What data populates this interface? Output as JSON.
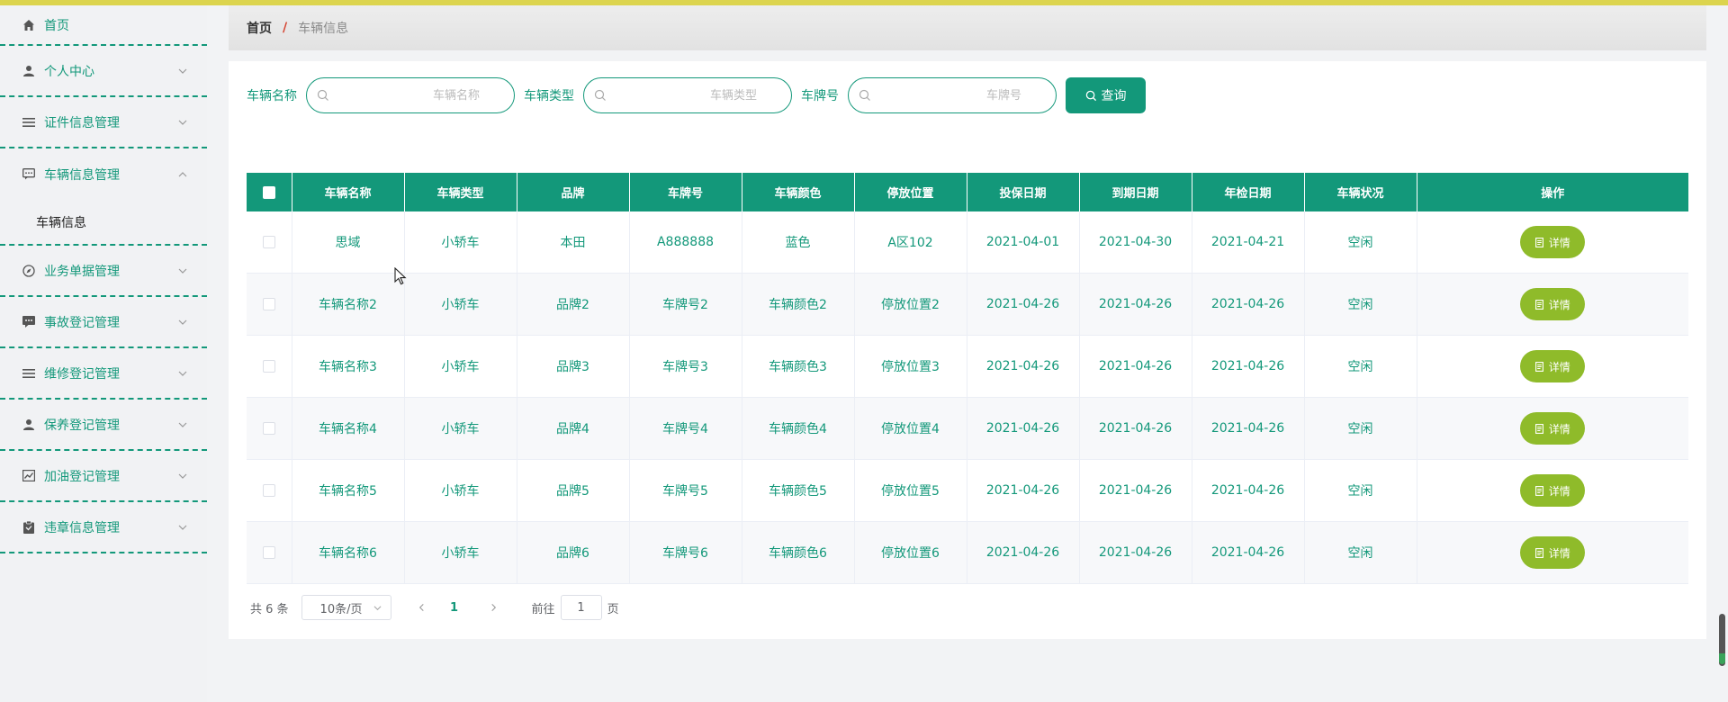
{
  "sidebar": {
    "items": [
      {
        "label": "首页",
        "icon": "home-icon",
        "expanded": false
      },
      {
        "label": "个人中心",
        "icon": "user-icon",
        "expanded": false
      },
      {
        "label": "证件信息管理",
        "icon": "list-icon",
        "expanded": false
      },
      {
        "label": "车辆信息管理",
        "icon": "chat-icon",
        "expanded": true,
        "subitems": [
          "车辆信息"
        ]
      },
      {
        "label": "业务单据管理",
        "icon": "compass-icon",
        "expanded": false
      },
      {
        "label": "事故登记管理",
        "icon": "message-icon",
        "expanded": false
      },
      {
        "label": "维修登记管理",
        "icon": "list-icon",
        "expanded": false
      },
      {
        "label": "保养登记管理",
        "icon": "user-icon",
        "expanded": false
      },
      {
        "label": "加油登记管理",
        "icon": "chart-icon",
        "expanded": false
      },
      {
        "label": "违章信息管理",
        "icon": "clipboard-icon",
        "expanded": false
      }
    ]
  },
  "breadcrumb": {
    "home": "首页",
    "separator": "/",
    "current": "车辆信息"
  },
  "search": {
    "name": {
      "label": "车辆名称",
      "placeholder": "车辆名称"
    },
    "type": {
      "label": "车辆类型",
      "placeholder": "车辆类型"
    },
    "plate": {
      "label": "车牌号",
      "placeholder": "车牌号"
    },
    "query_label": "查询"
  },
  "table": {
    "columns": [
      "车辆名称",
      "车辆类型",
      "品牌",
      "车牌号",
      "车辆颜色",
      "停放位置",
      "投保日期",
      "到期日期",
      "年检日期",
      "车辆状况",
      "操作"
    ],
    "rows": [
      [
        "思域",
        "小轿车",
        "本田",
        "A888888",
        "蓝色",
        "A区102",
        "2021-04-01",
        "2021-04-30",
        "2021-04-21",
        "空闲"
      ],
      [
        "车辆名称2",
        "小轿车",
        "品牌2",
        "车牌号2",
        "车辆颜色2",
        "停放位置2",
        "2021-04-26",
        "2021-04-26",
        "2021-04-26",
        "空闲"
      ],
      [
        "车辆名称3",
        "小轿车",
        "品牌3",
        "车牌号3",
        "车辆颜色3",
        "停放位置3",
        "2021-04-26",
        "2021-04-26",
        "2021-04-26",
        "空闲"
      ],
      [
        "车辆名称4",
        "小轿车",
        "品牌4",
        "车牌号4",
        "车辆颜色4",
        "停放位置4",
        "2021-04-26",
        "2021-04-26",
        "2021-04-26",
        "空闲"
      ],
      [
        "车辆名称5",
        "小轿车",
        "品牌5",
        "车牌号5",
        "车辆颜色5",
        "停放位置5",
        "2021-04-26",
        "2021-04-26",
        "2021-04-26",
        "空闲"
      ],
      [
        "车辆名称6",
        "小轿车",
        "品牌6",
        "车牌号6",
        "车辆颜色6",
        "停放位置6",
        "2021-04-26",
        "2021-04-26",
        "2021-04-26",
        "空闲"
      ]
    ],
    "detail_label": "详情"
  },
  "pagination": {
    "total": "共 6 条",
    "page_size": "10条/页",
    "current_page": "1",
    "goto_prefix": "前往",
    "goto_value": "1",
    "goto_suffix": "页"
  },
  "colors": {
    "primary": "#13987a",
    "detail_button": "#8fbb2a",
    "topbar": "#dcd44e",
    "breadcrumb_sep": "#d5422f"
  }
}
